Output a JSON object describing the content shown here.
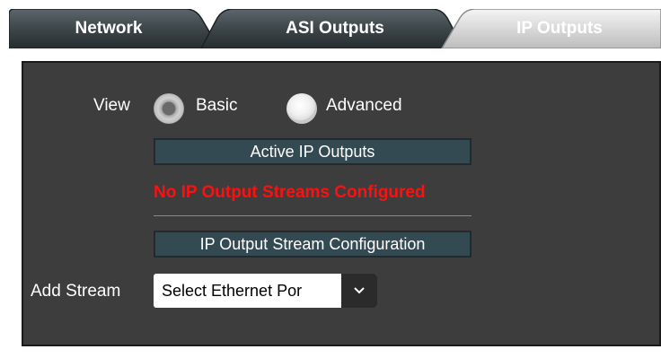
{
  "tabs": [
    {
      "label": "Network"
    },
    {
      "label": "ASI Outputs"
    },
    {
      "label": "IP Outputs"
    }
  ],
  "active_tab": "IP Outputs",
  "view": {
    "label": "View",
    "options": [
      "Basic",
      "Advanced"
    ],
    "selected": "Basic"
  },
  "active_outputs": {
    "header": "Active IP Outputs",
    "warning": "No IP Output Streams Configured",
    "warning_color": "#ff0f0f"
  },
  "stream_config": {
    "header": "IP Output Stream Configuration",
    "add_label": "Add Stream",
    "select_value": "Select Ethernet Por"
  },
  "colors": {
    "panel_bg": "#3d3d3d",
    "section_bar": "#344a53",
    "active_tab": "#e0e0e0",
    "inactive_tab": "#33393c"
  }
}
